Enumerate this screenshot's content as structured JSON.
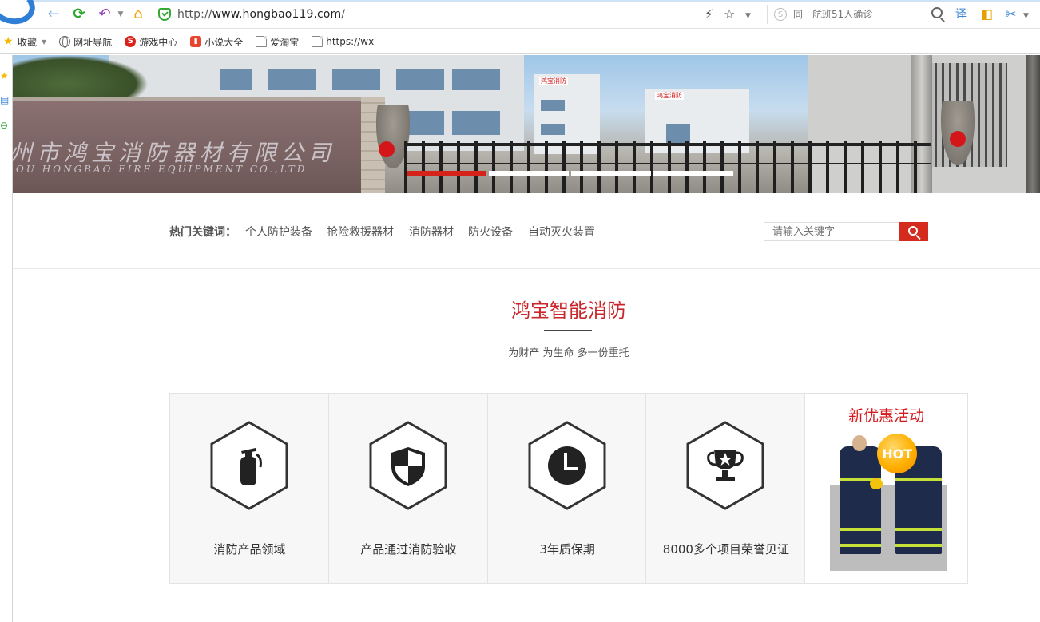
{
  "browser": {
    "url_prefix": "http://",
    "url_host": "www.hongbao119.com",
    "url_suffix": "/",
    "search_placeholder": "同一航班51人确诊"
  },
  "bookmarks": [
    {
      "label": "收藏",
      "icon": "star-icon"
    },
    {
      "label": "网址导航",
      "icon": "globe-icon"
    },
    {
      "label": "游戏中心",
      "icon": "game-icon"
    },
    {
      "label": "小说大全",
      "icon": "novel-icon"
    },
    {
      "label": "爱淘宝",
      "icon": "page-icon"
    },
    {
      "label": "https://wx",
      "icon": "page-icon"
    }
  ],
  "banner": {
    "sign_cn": "州市鸿宝消防器材有限公司",
    "sign_en": "OU HONGBAO FIRE EQUIPMENT CO.,LTD",
    "slides": 4,
    "active_slide": 1
  },
  "keywords": {
    "label": "热门关键词：",
    "items": [
      "个人防护装备",
      "抢险救援器材",
      "消防器材",
      "防火设备",
      "自动灭火装置"
    ],
    "search_placeholder": "请输入关键字"
  },
  "section": {
    "title": "鸿宝智能消防",
    "subtitle": "为财产 为生命 多一份重托"
  },
  "features": [
    {
      "label": "消防产品领域",
      "icon": "fire-extinguisher-icon"
    },
    {
      "label": "产品通过消防验收",
      "icon": "shield-icon"
    },
    {
      "label": "3年质保期",
      "icon": "clock-icon"
    },
    {
      "label": "8000多个项目荣誉见证",
      "icon": "trophy-icon"
    }
  ],
  "promo": {
    "title": "新优惠活动",
    "badge": "HOT"
  },
  "colors": {
    "accent_red": "#d52b1e",
    "title_red": "#c8262a",
    "browser_blue": "#2f7fd6"
  }
}
